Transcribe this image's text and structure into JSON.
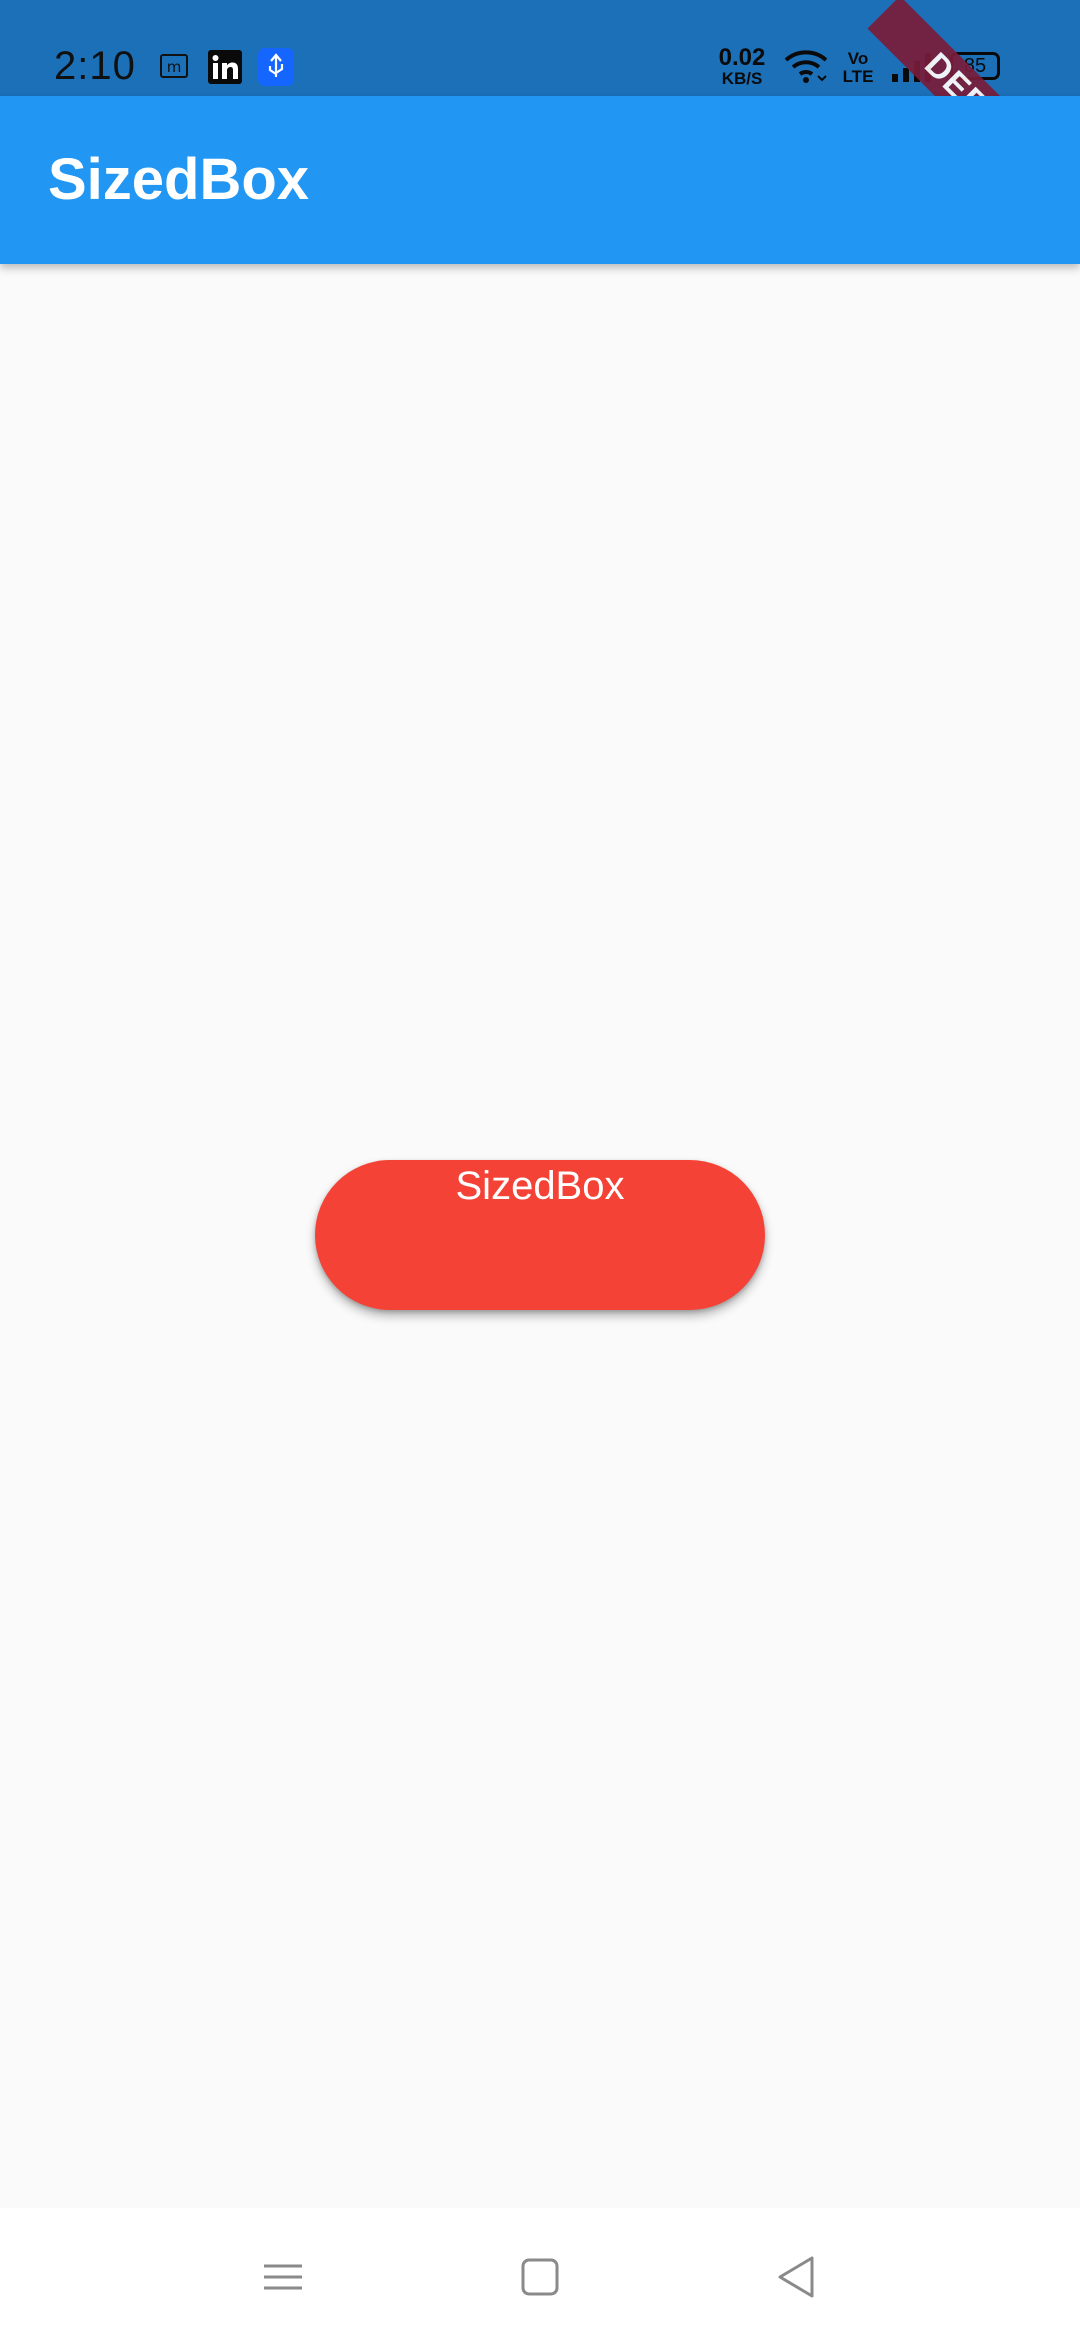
{
  "status_bar": {
    "time": "2:10",
    "notification_icons": [
      "m-app-icon",
      "linkedin-icon",
      "usb-icon"
    ],
    "network_speed_value": "0.02",
    "network_speed_unit": "KB/S",
    "volte_label": "Vo LTE",
    "battery_level": "85",
    "color": "#1b70b8"
  },
  "debug_banner": {
    "label": "DEBUG",
    "color": "#7a1c3a"
  },
  "app_bar": {
    "title": "SizedBox",
    "color": "#2196f3"
  },
  "main": {
    "button_label": "SizedBox",
    "button_color": "#f44336",
    "background": "#fafafa"
  },
  "nav_bar": {
    "items": [
      "menu-icon",
      "home-square-icon",
      "back-triangle-icon"
    ]
  }
}
